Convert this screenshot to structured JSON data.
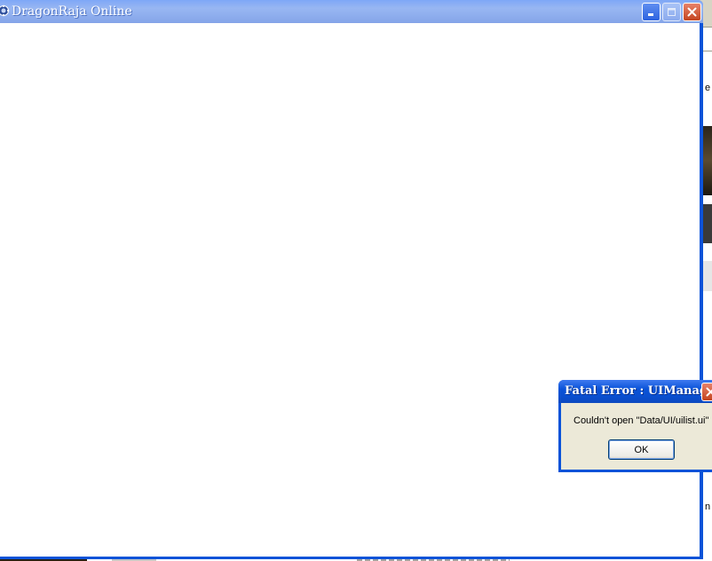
{
  "main_window": {
    "title": "DragonRaja Online",
    "icon": "dragonraja-app-icon",
    "controls": {
      "minimize_icon": "minimize-icon",
      "maximize_icon": "maximize-icon",
      "close_icon": "close-icon"
    }
  },
  "background_window": {
    "text_fragment_1": "e",
    "text_fragment_2": "n"
  },
  "dialog": {
    "title": "Fatal Error : UIManager",
    "message": "Couldn't open \"Data/UI/uilist.ui\"",
    "ok_label": "OK",
    "close_icon": "close-icon"
  },
  "colors": {
    "xp_blue": "#0a53d8",
    "dialog_face": "#ece9d8",
    "close_red": "#c4441f",
    "inactive_titlebar": "#91b0ef"
  }
}
